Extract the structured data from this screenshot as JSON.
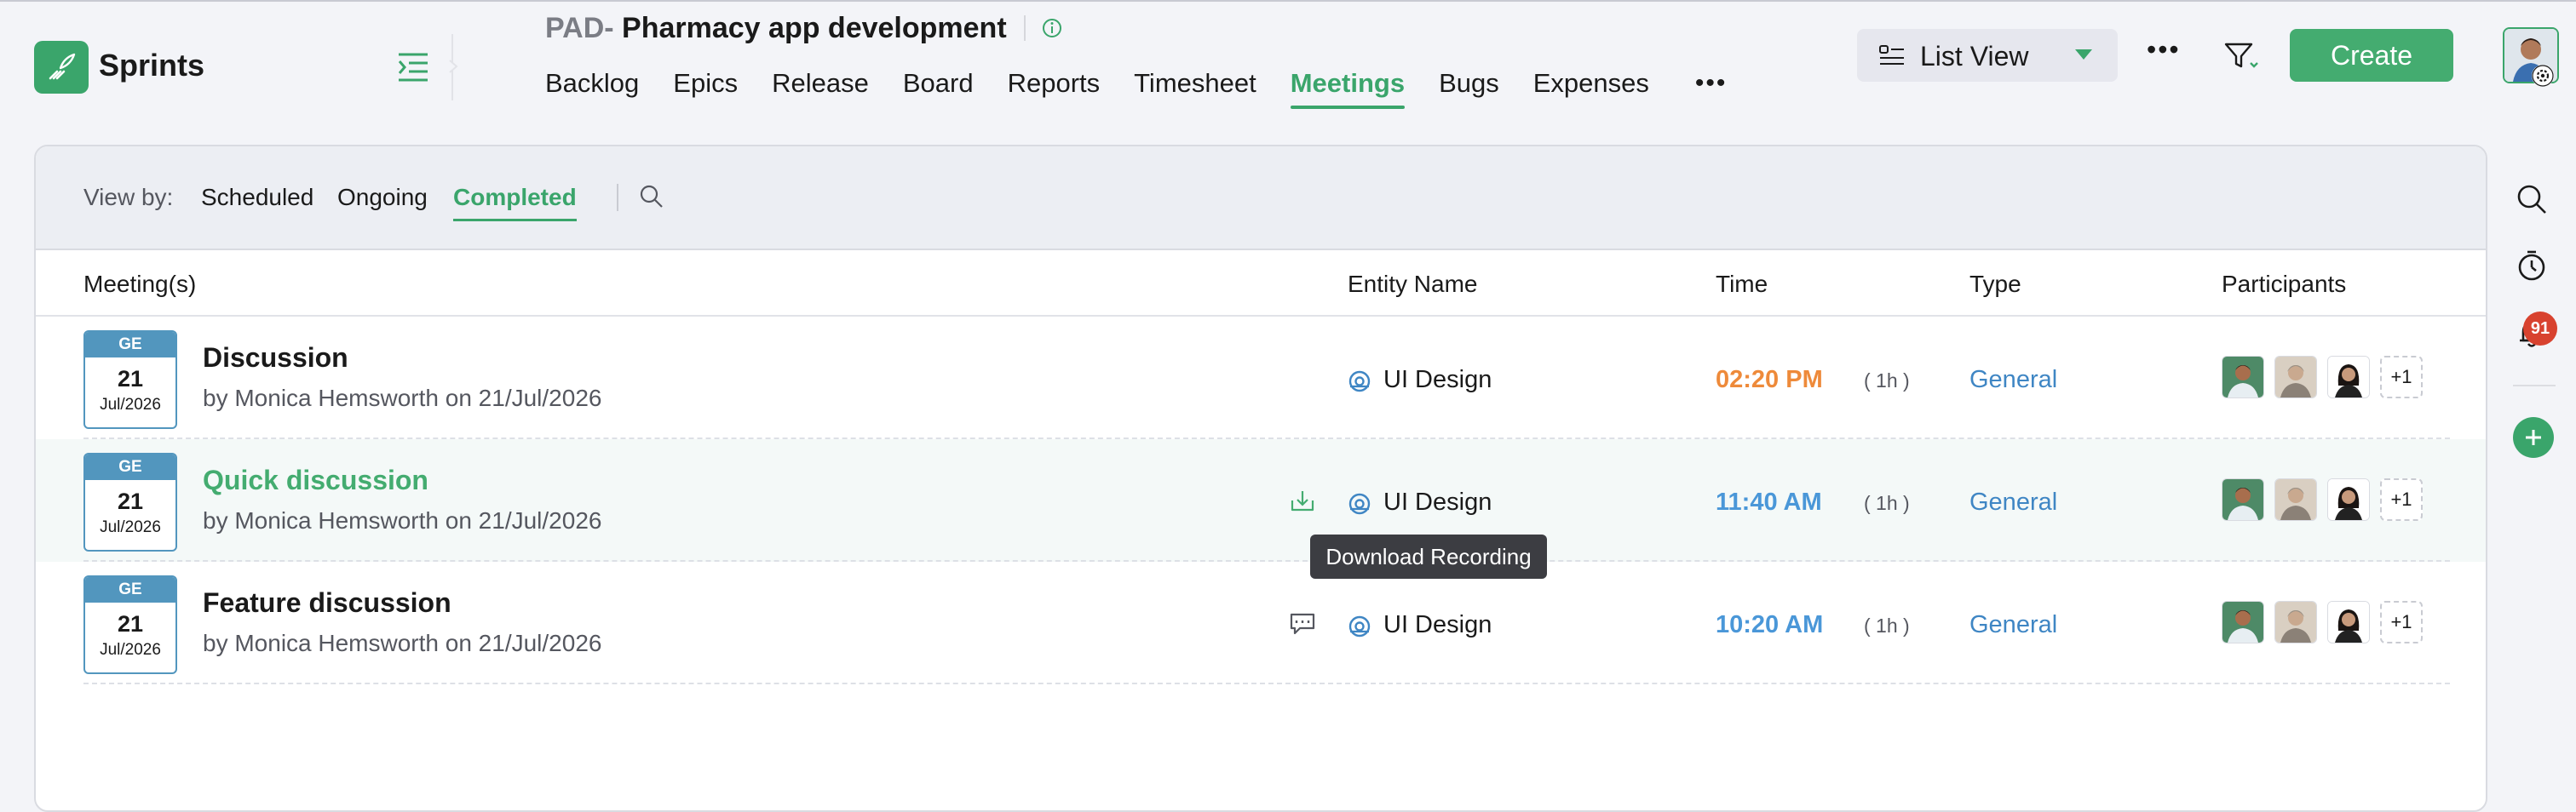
{
  "app": {
    "name": "Sprints",
    "brand_color": "#3aa56b"
  },
  "project": {
    "code": "PAD-",
    "name": "Pharmacy app development"
  },
  "nav": {
    "tabs": [
      {
        "label": "Backlog"
      },
      {
        "label": "Epics"
      },
      {
        "label": "Release"
      },
      {
        "label": "Board"
      },
      {
        "label": "Reports"
      },
      {
        "label": "Timesheet"
      },
      {
        "label": "Meetings",
        "active": true
      },
      {
        "label": "Bugs"
      },
      {
        "label": "Expenses"
      }
    ],
    "more_label": "•••"
  },
  "header": {
    "view_select": "List View",
    "more_label": "•••",
    "create_label": "Create"
  },
  "rail": {
    "notification_count": "91"
  },
  "viewbar": {
    "label": "View by:",
    "tabs": [
      {
        "label": "Scheduled"
      },
      {
        "label": "Ongoing"
      },
      {
        "label": "Completed",
        "active": true
      }
    ]
  },
  "columns": {
    "meetings": "Meeting(s)",
    "entity": "Entity Name",
    "time": "Time",
    "type": "Type",
    "participants": "Participants"
  },
  "rows": [
    {
      "date_tag": "GE",
      "day": "21",
      "month_year": "Jul/2026",
      "title": "Discussion",
      "subtitle": "by Monica Hemsworth on 21/Jul/2026",
      "entity": "UI Design",
      "time": "02:20 PM",
      "duration": "( 1h )",
      "type": "General",
      "participants_more": "+1",
      "time_color": "#ee8a3a"
    },
    {
      "date_tag": "GE",
      "day": "21",
      "month_year": "Jul/2026",
      "title": "Quick discussion",
      "subtitle": "by Monica Hemsworth on 21/Jul/2026",
      "entity": "UI Design",
      "time": "11:40 AM",
      "duration": "( 1h )",
      "type": "General",
      "participants_more": "+1",
      "action_icon": "download-recording-icon"
    },
    {
      "date_tag": "GE",
      "day": "21",
      "month_year": "Jul/2026",
      "title": "Feature discussion",
      "subtitle": "by Monica Hemsworth on 21/Jul/2026",
      "entity": "UI Design",
      "time": "10:20 AM",
      "duration": "( 1h )",
      "type": "General",
      "participants_more": "+1",
      "action_icon": "chat-summary-icon"
    }
  ],
  "tooltip": {
    "text": "Download Recording"
  }
}
